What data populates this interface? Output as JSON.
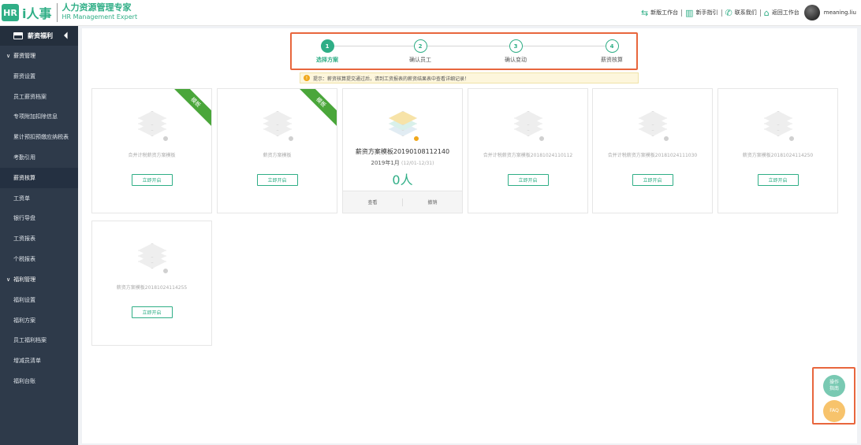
{
  "header": {
    "logo_hr": "HR",
    "logo_brand": "i人事",
    "logo_title": "人力资源管理专家",
    "logo_subtitle": "HR Management Expert",
    "links": [
      {
        "label": "新版工作台",
        "icon": "swap-icon"
      },
      {
        "label": "新手指引",
        "icon": "book-icon"
      },
      {
        "label": "联系我们",
        "icon": "phone-icon"
      },
      {
        "label": "返回工作台",
        "icon": "home-icon"
      }
    ],
    "username": "meaning.liu"
  },
  "sidebar": {
    "title": "薪资福利",
    "groups": [
      {
        "label": "薪资管理",
        "items": [
          "薪资设置",
          "员工薪资档案",
          "专项附加扣除信息",
          "累计预扣预缴应纳税表",
          "考勤引用",
          "薪资核算",
          "工资单",
          "银行导盘",
          "工资报表",
          "个税报表"
        ]
      },
      {
        "label": "福利管理",
        "items": [
          "福利设置",
          "福利方案",
          "员工福利档案",
          "增减员清单",
          "福利台账"
        ]
      }
    ],
    "active_item": "薪资核算"
  },
  "steps": [
    {
      "num": "1",
      "label": "选择方案"
    },
    {
      "num": "2",
      "label": "确认员工"
    },
    {
      "num": "3",
      "label": "确认变动"
    },
    {
      "num": "4",
      "label": "薪资核算"
    }
  ],
  "tip": {
    "icon": "!",
    "text": "提示：薪资核算提交通过后，请到工资报表的薪资结果表中查看详细记录！"
  },
  "cards": [
    {
      "name": "合并计税薪资方案模板",
      "ribbon": "模板",
      "button": "立即开启"
    },
    {
      "name": "薪资方案模板",
      "ribbon": "模板",
      "button": "立即开启"
    },
    {
      "name": "薪资方案模板20190108112140",
      "period": "2019年1月",
      "period_range": "(12/01-12/31)",
      "count": "0人",
      "actions": [
        "查看",
        "撤销"
      ]
    },
    {
      "name": "合并计税薪资方案模板20181024110112",
      "button": "立即开启"
    },
    {
      "name": "合并计税薪资方案模板20181024111030",
      "button": "立即开启"
    },
    {
      "name": "薪资方案模板20181024114250",
      "button": "立即开启"
    },
    {
      "name": "薪资方案模板20181024114255",
      "button": "立即开启"
    }
  ],
  "float": {
    "guide": "操作\n指南",
    "faq": "FAQ"
  },
  "colors": {
    "primary": "#2fae86",
    "highlight_border": "#e8663d",
    "ribbon": "#4aa63a",
    "sidebar_bg": "#2e3a4a"
  }
}
